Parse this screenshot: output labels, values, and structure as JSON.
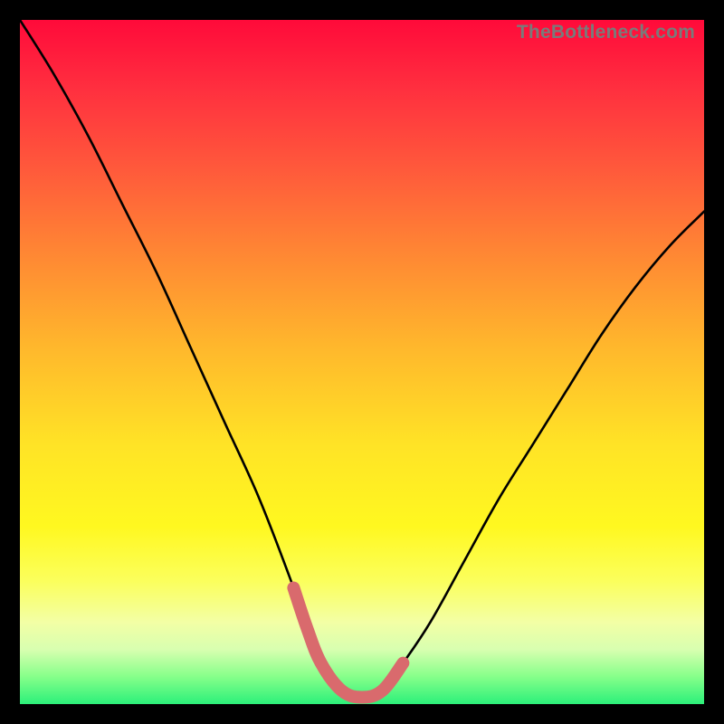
{
  "watermark": "TheBottleneck.com",
  "chart_data": {
    "type": "line",
    "title": "",
    "xlabel": "",
    "ylabel": "",
    "xlim": [
      0,
      100
    ],
    "ylim": [
      0,
      100
    ],
    "series": [
      {
        "name": "bottleneck-curve",
        "x": [
          0,
          5,
          10,
          15,
          20,
          25,
          30,
          35,
          40,
          42,
          44,
          47,
          50,
          53,
          56,
          60,
          65,
          70,
          75,
          80,
          85,
          90,
          95,
          100
        ],
        "values": [
          100,
          92,
          83,
          73,
          63,
          52,
          41,
          30,
          17,
          11,
          6,
          2,
          1,
          2,
          6,
          12,
          21,
          30,
          38,
          46,
          54,
          61,
          67,
          72
        ]
      }
    ],
    "highlight": {
      "name": "optimal-range",
      "x": [
        40,
        42,
        44,
        47,
        50,
        53,
        56
      ],
      "values": [
        17,
        11,
        6,
        2,
        1,
        2,
        6
      ]
    },
    "gradient_stops": [
      {
        "pos": 0,
        "color": "#ff0a3a"
      },
      {
        "pos": 50,
        "color": "#ffe326"
      },
      {
        "pos": 100,
        "color": "#2cf07a"
      }
    ]
  }
}
